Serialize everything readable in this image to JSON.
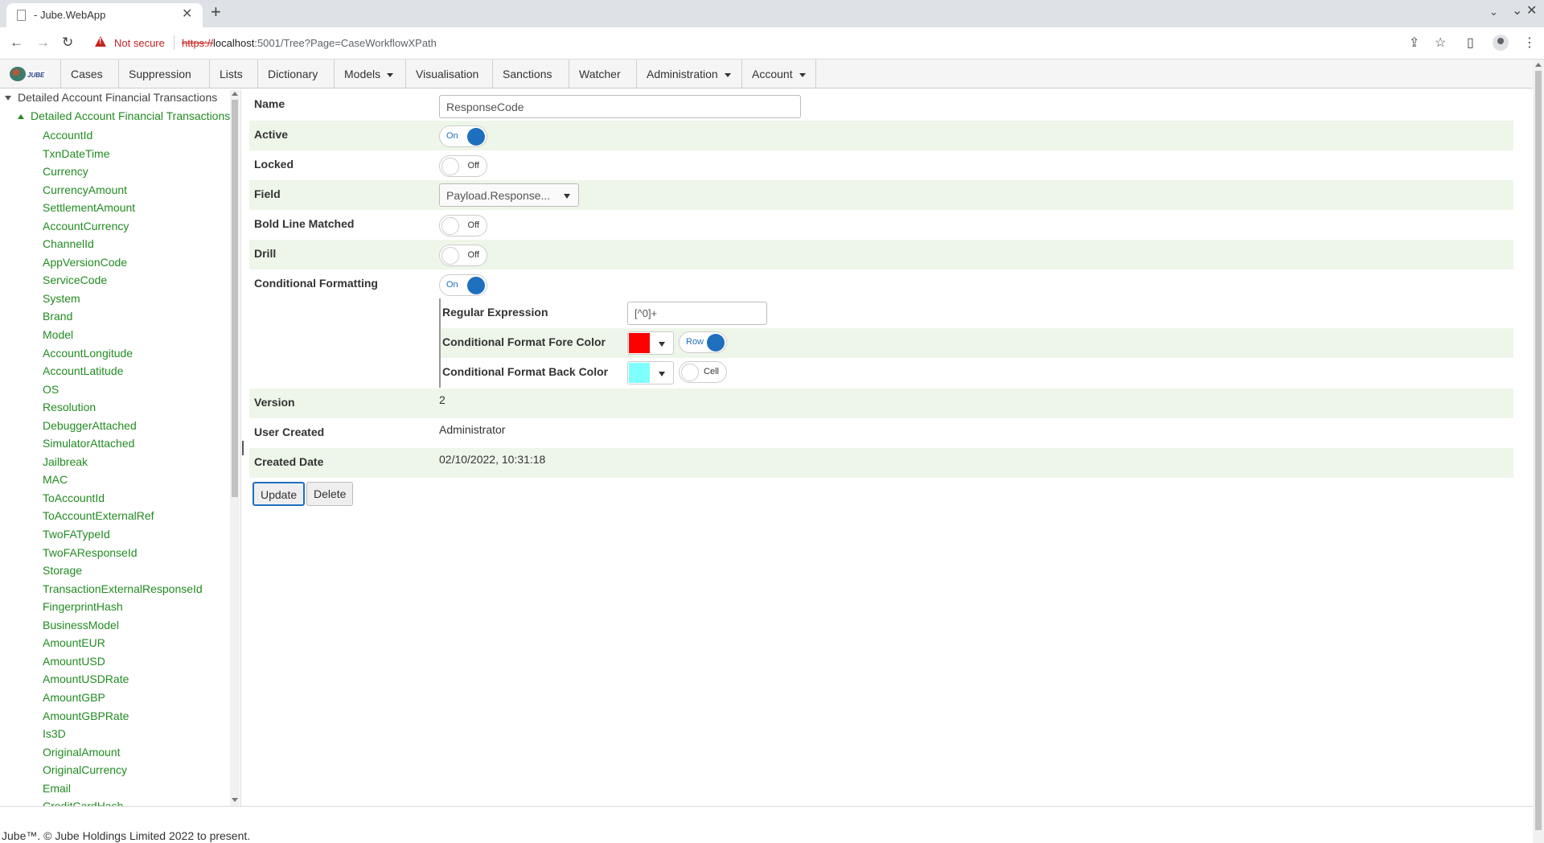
{
  "browser": {
    "tab_title": "- Jube.WebApp",
    "close_glyph": "✕",
    "new_tab_glyph": "+",
    "not_secure": "Not secure",
    "url_scheme": "https://",
    "url_host": "localhost",
    "url_path": ":5001/Tree?Page=CaseWorkflowXPath"
  },
  "menu": {
    "items": [
      {
        "label": "Cases"
      },
      {
        "label": "Suppression"
      },
      {
        "label": "Lists"
      },
      {
        "label": "Dictionary"
      },
      {
        "label": "Models"
      },
      {
        "label": "Visualisation"
      },
      {
        "label": "Sanctions"
      },
      {
        "label": "Watcher"
      },
      {
        "label": "Administration"
      },
      {
        "label": "Account"
      }
    ]
  },
  "tree": {
    "root": "Detailed Account Financial Transactions",
    "node": "Detailed Account Financial Transactions",
    "items": [
      "AccountId",
      "TxnDateTime",
      "Currency",
      "CurrencyAmount",
      "SettlementAmount",
      "AccountCurrency",
      "ChannelId",
      "AppVersionCode",
      "ServiceCode",
      "System",
      "Brand",
      "Model",
      "AccountLongitude",
      "AccountLatitude",
      "OS",
      "Resolution",
      "DebuggerAttached",
      "SimulatorAttached",
      "Jailbreak",
      "MAC",
      "ToAccountId",
      "ToAccountExternalRef",
      "TwoFATypeId",
      "TwoFAResponseId",
      "Storage",
      "TransactionExternalResponseId",
      "FingerprintHash",
      "BusinessModel",
      "AmountEUR",
      "AmountUSD",
      "AmountUSDRate",
      "AmountGBP",
      "AmountGBPRate",
      "Is3D",
      "OriginalAmount",
      "OriginalCurrency",
      "Email",
      "CreditCardHash"
    ]
  },
  "form": {
    "name_label": "Name",
    "name_value": "ResponseCode",
    "active_label": "Active",
    "active_state": "On",
    "locked_label": "Locked",
    "locked_state": "Off",
    "field_label": "Field",
    "field_value": "Payload.Response...",
    "bold_label": "Bold Line Matched",
    "bold_state": "Off",
    "drill_label": "Drill",
    "drill_state": "Off",
    "cf_label": "Conditional Formatting",
    "cf_state": "On",
    "regex_label": "Regular Expression",
    "regex_value": "[^0]+",
    "fore_label": "Conditional Format Fore Color",
    "fore_color": "#ff0000",
    "fore_scope": "Row",
    "back_label": "Conditional Format Back Color",
    "back_color": "#80ffff",
    "back_scope": "Cell",
    "version_label": "Version",
    "version_value": "2",
    "user_label": "User Created",
    "user_value": "Administrator",
    "date_label": "Created Date",
    "date_value": "02/10/2022, 10:31:18",
    "update_label": "Update",
    "delete_label": "Delete"
  },
  "footer": {
    "text": "Jube™. © Jube Holdings Limited 2022 to present."
  },
  "colors": {
    "accent": "#1f6fbf",
    "tree_green": "#228b22",
    "alt_row": "#eef6ea",
    "warning": "#c5221f"
  }
}
